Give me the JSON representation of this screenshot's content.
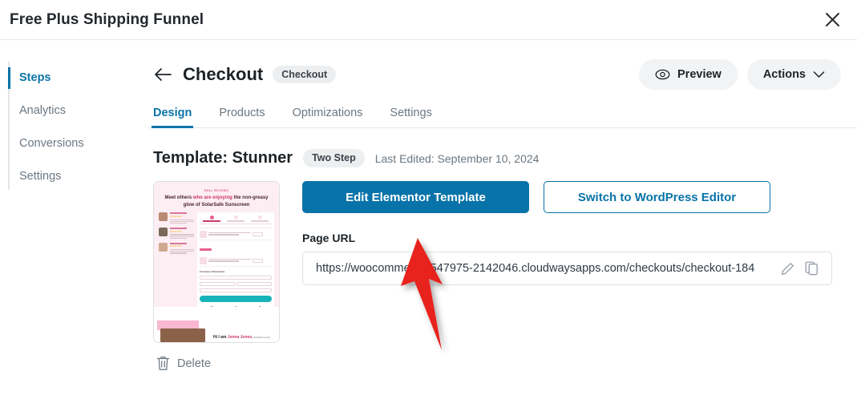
{
  "window": {
    "title": "Free Plus Shipping Funnel",
    "close_icon": "close-icon"
  },
  "sidebar": {
    "items": [
      {
        "label": "Steps",
        "active": true
      },
      {
        "label": "Analytics",
        "active": false
      },
      {
        "label": "Conversions",
        "active": false
      },
      {
        "label": "Settings",
        "active": false
      }
    ]
  },
  "header": {
    "back_icon": "arrow-left-icon",
    "title": "Checkout",
    "badge": "Checkout",
    "preview_label": "Preview",
    "preview_icon": "eye-icon",
    "actions_label": "Actions",
    "actions_icon": "chevron-down-icon"
  },
  "tabs": [
    {
      "label": "Design",
      "active": true
    },
    {
      "label": "Products",
      "active": false
    },
    {
      "label": "Optimizations",
      "active": false
    },
    {
      "label": "Settings",
      "active": false
    }
  ],
  "template": {
    "title": "Template: Stunner",
    "badge": "Two Step",
    "last_edited": "Last Edited: September 10, 2024",
    "delete_label": "Delete",
    "delete_icon": "trash-icon",
    "thumbnail": {
      "eyebrow": "REAL REVIEWS",
      "headline_1": "Meet others ",
      "headline_em": "who are enjoying ",
      "headline_2": "the non-greasy glow of SolarSafe Sunscreen",
      "section_customer": "Customer Information",
      "cta": "PICK ME UP",
      "logo_pre": "Hi I am ",
      "logo_name": "Jenna Jones,",
      "logo_post": " SolarSafe founder"
    }
  },
  "actions": {
    "edit_elementor": "Edit Elementor Template",
    "switch_wordpress": "Switch to WordPress Editor"
  },
  "page_url": {
    "label": "Page URL",
    "value": "https://woocommerce-547975-2142046.cloudwaysapps.com/checkouts/checkout-184",
    "edit_icon": "pencil-icon",
    "copy_icon": "copy-icon"
  },
  "annotation": {
    "arrow_color": "#e8201c",
    "points_to": "Edit Elementor Template"
  },
  "colors": {
    "accent_blue": "#0873a8",
    "link_blue": "#0a74a8",
    "text": "#1d2327",
    "muted": "#6c7781",
    "border": "#e4e6eb"
  }
}
